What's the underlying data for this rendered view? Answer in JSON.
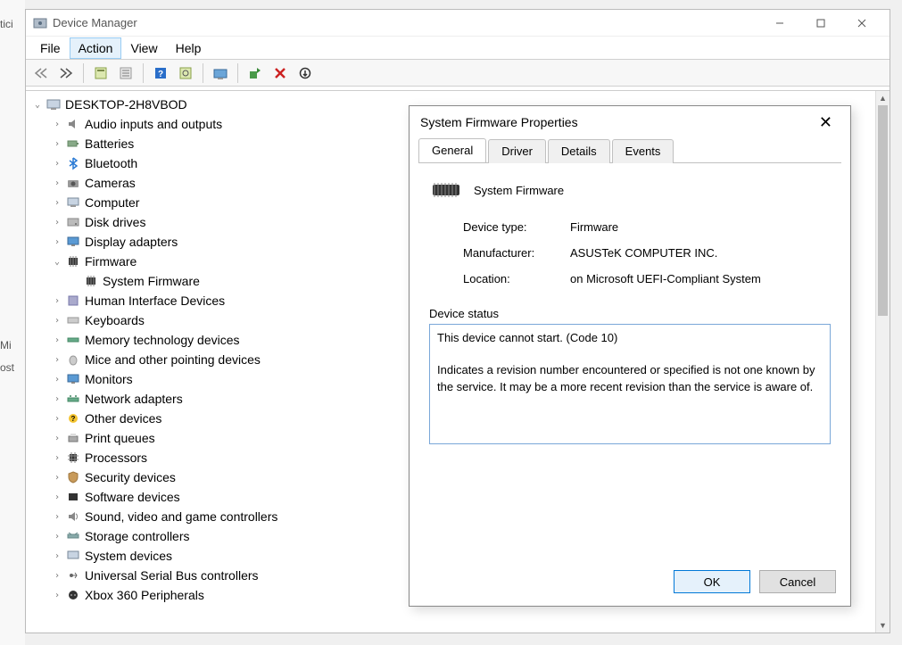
{
  "window": {
    "title": "Device Manager"
  },
  "menubar": [
    "File",
    "Action",
    "View",
    "Help"
  ],
  "menubar_active": 1,
  "tree": {
    "root": "DESKTOP-2H8VBOD",
    "items": [
      {
        "label": "Audio inputs and outputs"
      },
      {
        "label": "Batteries"
      },
      {
        "label": "Bluetooth"
      },
      {
        "label": "Cameras"
      },
      {
        "label": "Computer"
      },
      {
        "label": "Disk drives"
      },
      {
        "label": "Display adapters"
      },
      {
        "label": "Firmware",
        "expanded": true,
        "children": [
          {
            "label": "System Firmware"
          }
        ]
      },
      {
        "label": "Human Interface Devices"
      },
      {
        "label": "Keyboards"
      },
      {
        "label": "Memory technology devices"
      },
      {
        "label": "Mice and other pointing devices"
      },
      {
        "label": "Monitors"
      },
      {
        "label": "Network adapters"
      },
      {
        "label": "Other devices"
      },
      {
        "label": "Print queues"
      },
      {
        "label": "Processors"
      },
      {
        "label": "Security devices"
      },
      {
        "label": "Software devices"
      },
      {
        "label": "Sound, video and game controllers"
      },
      {
        "label": "Storage controllers"
      },
      {
        "label": "System devices"
      },
      {
        "label": "Universal Serial Bus controllers"
      },
      {
        "label": "Xbox 360 Peripherals"
      }
    ]
  },
  "modal": {
    "title": "System Firmware Properties",
    "tabs": [
      "General",
      "Driver",
      "Details",
      "Events"
    ],
    "active_tab": 0,
    "device_name": "System Firmware",
    "fields": {
      "device_type_label": "Device type:",
      "device_type_value": "Firmware",
      "manufacturer_label": "Manufacturer:",
      "manufacturer_value": "ASUSTeK COMPUTER INC.",
      "location_label": "Location:",
      "location_value": "on Microsoft UEFI-Compliant System"
    },
    "status_label": "Device status",
    "status_text": "This device cannot start. (Code 10)\n\nIndicates a revision number encountered or specified is not one known by the service. It may be a more recent revision than the service is aware of.",
    "ok_label": "OK",
    "cancel_label": "Cancel"
  },
  "left_fragments": {
    "f1": "tici",
    "f2": "Mi",
    "f3": "ost"
  }
}
